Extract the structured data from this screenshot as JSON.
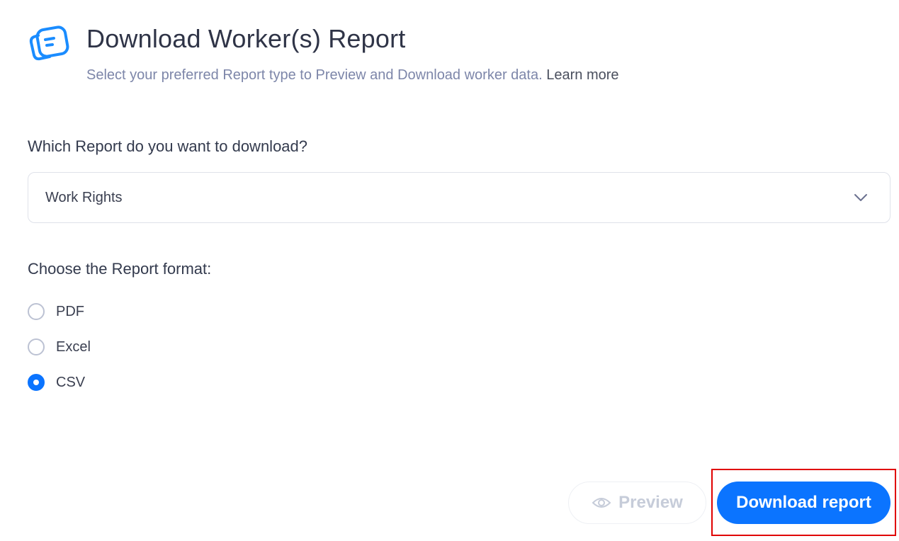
{
  "header": {
    "icon": "document-icon",
    "title": "Download Worker(s) Report",
    "subtitle": "Select your preferred Report type to Preview and Download worker data.",
    "learn_more": "Learn more"
  },
  "report_select": {
    "label": "Which Report do you want to download?",
    "selected": "Work Rights"
  },
  "format": {
    "label": "Choose the Report format:",
    "options": [
      {
        "label": "PDF",
        "checked": false
      },
      {
        "label": "Excel",
        "checked": false
      },
      {
        "label": "CSV",
        "checked": true
      }
    ]
  },
  "actions": {
    "preview_label": "Preview",
    "download_label": "Download report"
  },
  "colors": {
    "accent": "#0b74ff",
    "highlight": "#e00000"
  }
}
